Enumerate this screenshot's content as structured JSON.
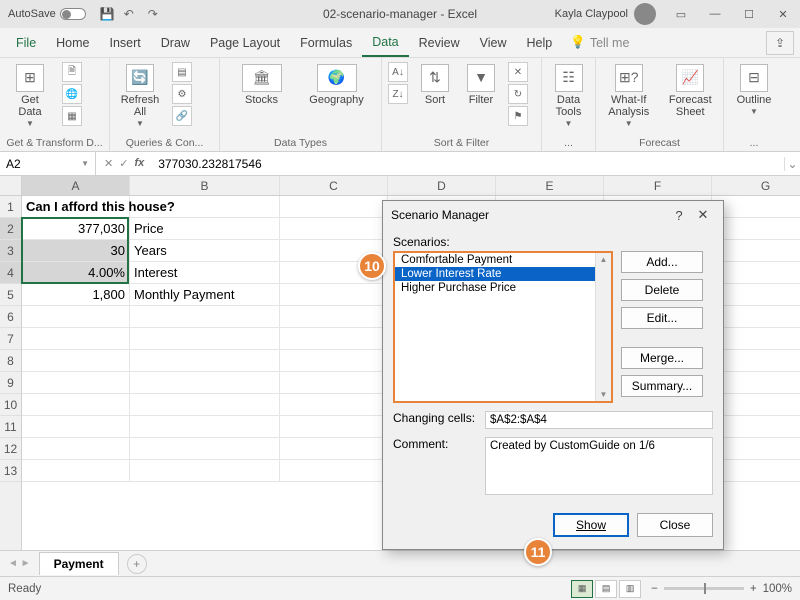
{
  "titlebar": {
    "autosave": "AutoSave",
    "title": "02-scenario-manager - Excel",
    "user": "Kayla Claypool"
  },
  "menubar": {
    "tabs": [
      "File",
      "Home",
      "Insert",
      "Draw",
      "Page Layout",
      "Formulas",
      "Data",
      "Review",
      "View",
      "Help"
    ],
    "active": "Data",
    "tellme": "Tell me"
  },
  "ribbon": {
    "groups": {
      "get_transform": {
        "label": "Get & Transform D...",
        "get_data": "Get\nData"
      },
      "queries": {
        "label": "Queries & Con...",
        "refresh_all": "Refresh\nAll"
      },
      "data_types": {
        "label": "Data Types",
        "stocks": "Stocks",
        "geography": "Geography"
      },
      "sort_filter": {
        "label": "Sort & Filter",
        "sort": "Sort",
        "filter": "Filter"
      },
      "data_tools": {
        "label": "...",
        "data_tools": "Data\nTools"
      },
      "forecast": {
        "label": "Forecast",
        "whatif": "What-If\nAnalysis",
        "forecast_sheet": "Forecast\nSheet"
      },
      "outline": {
        "label": "...",
        "outline": "Outline"
      }
    }
  },
  "formulabar": {
    "namebox": "A2",
    "formula": "377030.232817546"
  },
  "columns": [
    "A",
    "B",
    "C",
    "D",
    "E",
    "F",
    "G"
  ],
  "rows": [
    "1",
    "2",
    "3",
    "4",
    "5",
    "6",
    "7",
    "8",
    "9",
    "10",
    "11",
    "12",
    "13"
  ],
  "cells": {
    "a1": "Can I afford this house?",
    "a2": "377,030",
    "b2": "Price",
    "a3": "30",
    "b3": "Years",
    "a4": "4.00%",
    "b4": "Interest",
    "a5": "1,800",
    "b5": "Monthly Payment"
  },
  "sheet": {
    "active": "Payment"
  },
  "status": {
    "ready": "Ready",
    "zoom": "100%"
  },
  "dialog": {
    "title": "Scenario Manager",
    "scenarios_label": "Scenarios:",
    "scenarios": [
      "Comfortable Payment",
      "Lower Interest Rate",
      "Higher Purchase Price"
    ],
    "selected": "Lower Interest Rate",
    "btn_add": "Add...",
    "btn_delete": "Delete",
    "btn_edit": "Edit...",
    "btn_merge": "Merge...",
    "btn_summary": "Summary...",
    "changing_label": "Changing cells:",
    "changing_val": "$A$2:$A$4",
    "comment_label": "Comment:",
    "comment_val": "Created by CustomGuide on 1/6",
    "btn_show": "Show",
    "btn_close": "Close"
  },
  "callouts": {
    "c10": "10",
    "c11": "11"
  }
}
